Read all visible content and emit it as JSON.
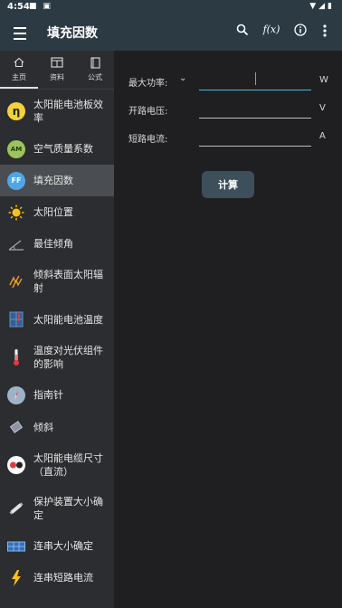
{
  "status": {
    "time": "4:54"
  },
  "app_bar": {
    "title": "填充因数",
    "fx_label": "f(x)"
  },
  "tabs": [
    {
      "label": "主页"
    },
    {
      "label": "资料"
    },
    {
      "label": "公式"
    }
  ],
  "nav": [
    {
      "label": "太阳能电池板效率",
      "icon_text": "η",
      "icon": "eta-icon"
    },
    {
      "label": "空气质量系数",
      "icon_text": "AM",
      "icon": "air-mass-icon"
    },
    {
      "label": "填充因数",
      "icon_text": "FF",
      "icon": "fill-factor-icon"
    },
    {
      "label": "太阳位置",
      "icon": "sun-icon"
    },
    {
      "label": "最佳倾角",
      "icon": "angle-icon"
    },
    {
      "label": "倾斜表面太阳辐射",
      "icon": "radiation-icon"
    },
    {
      "label": "太阳能电池温度",
      "icon": "panel-temp-icon"
    },
    {
      "label": "温度对光伏组件的影响",
      "icon": "thermometer-icon"
    },
    {
      "label": "指南针",
      "icon": "compass-icon"
    },
    {
      "label": "倾斜",
      "icon": "tilt-icon"
    },
    {
      "label": "太阳能电缆尺寸（直流）",
      "icon": "cable-icon"
    },
    {
      "label": "保护装置大小确定",
      "icon": "fuse-icon"
    },
    {
      "label": "连串大小确定",
      "icon": "string-icon"
    },
    {
      "label": "连串短路电流",
      "icon": "lightning-icon"
    }
  ],
  "form": {
    "max_power": {
      "label": "最大功率:",
      "unit": "W",
      "value": ""
    },
    "open_voltage": {
      "label": "开路电压:",
      "unit": "V",
      "value": ""
    },
    "short_current": {
      "label": "短路电流:",
      "unit": "A",
      "value": ""
    },
    "calculate_label": "计算"
  },
  "colors": {
    "app_bar": "#2b3a43",
    "sidebar": "#2b2d30",
    "active_item": "#4a4d52",
    "accent": "#4fb3e8"
  }
}
